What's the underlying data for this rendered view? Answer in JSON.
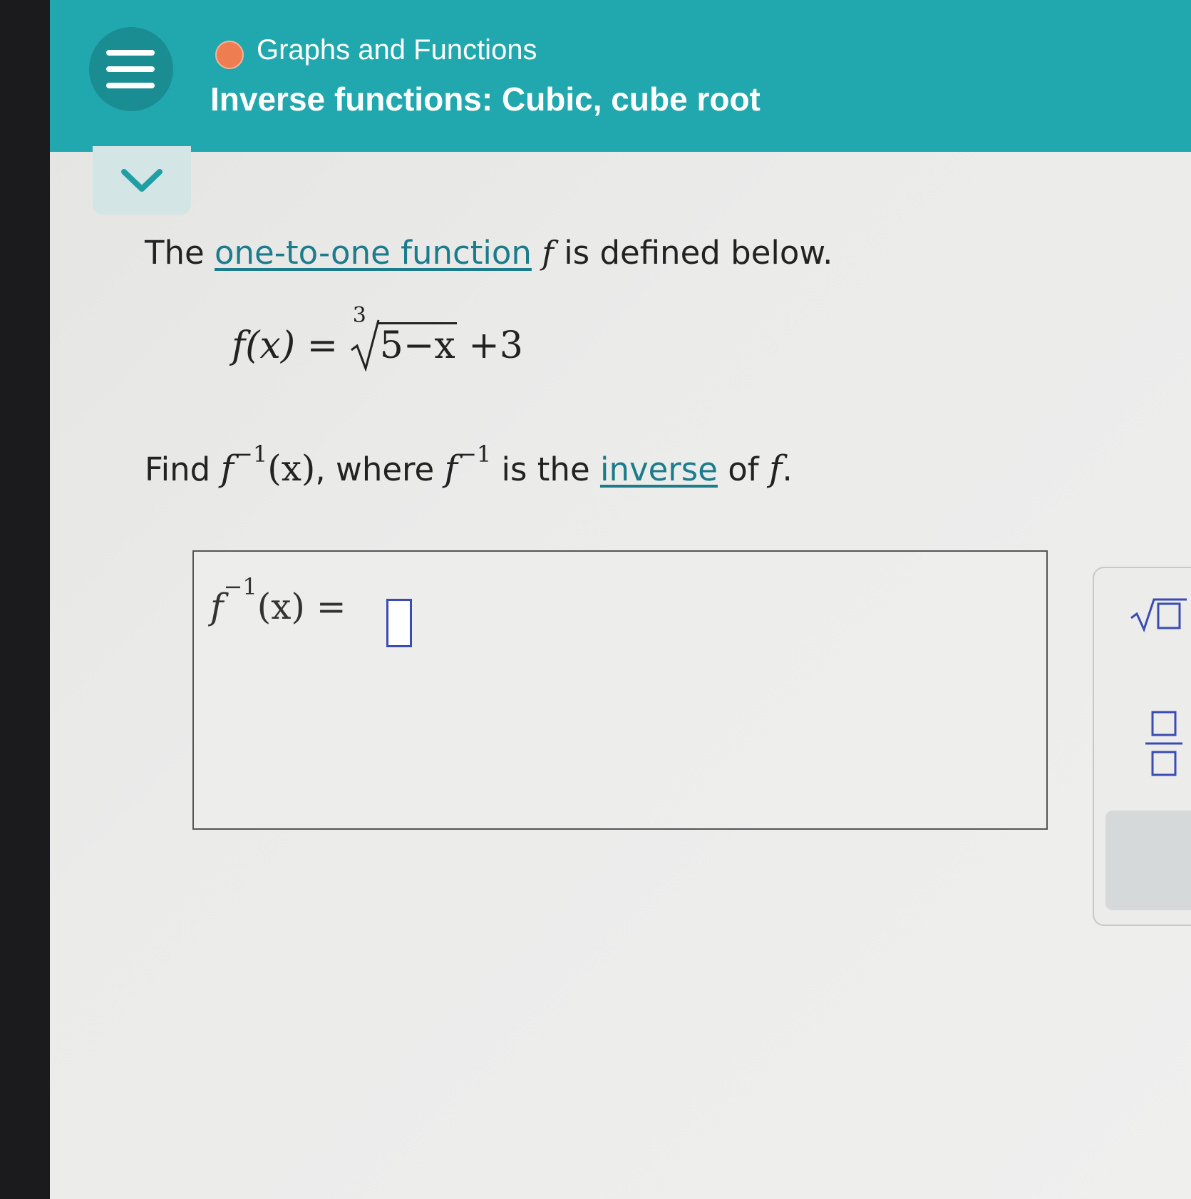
{
  "header": {
    "topic": "Graphs and Functions",
    "lesson": "Inverse functions: Cubic, cube root"
  },
  "icons": {
    "menu": "hamburger-menu-icon",
    "topic_status": "orange-dot-icon",
    "collapse": "chevron-down-icon",
    "sqrt_tool": "square-root-icon",
    "fraction_tool": "fraction-icon"
  },
  "colors": {
    "header_bg": "#21a8ae",
    "menu_bg": "#1a8d92",
    "topic_dot": "#ef7d52",
    "link": "#1b7c8c",
    "input_border": "#3a4bb3"
  },
  "problem": {
    "intro_prefix": "The ",
    "intro_link": "one-to-one function",
    "intro_var": "f",
    "intro_suffix": " is defined below.",
    "formula_lhs": "f(x) = ",
    "formula_root_index": "3",
    "formula_radicand": "5−x",
    "formula_tail": " +3",
    "find_prefix": "Find ",
    "find_f": "f",
    "find_exp": "−1",
    "find_arg": "(x)",
    "find_where": ", where ",
    "where_f": "f",
    "where_exp": "−1",
    "find_is_the": " is the ",
    "find_link": "inverse",
    "find_of": " of ",
    "find_f2": "f",
    "find_end": "."
  },
  "answer": {
    "f": "f",
    "exp": "−1",
    "arg": "(x)",
    "eq": " = ",
    "value": ""
  }
}
